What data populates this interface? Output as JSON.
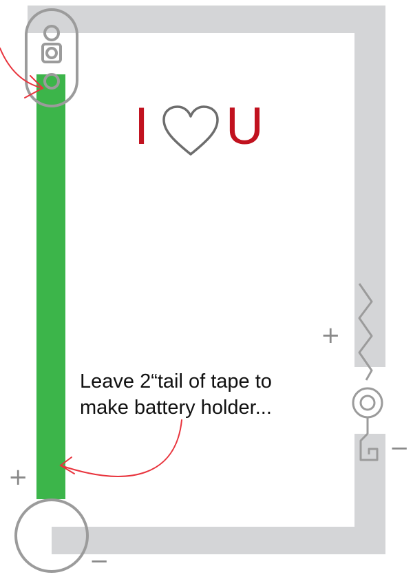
{
  "title": {
    "left_letter": "I",
    "right_letter": "U",
    "heart_icon": "heart-outline-icon",
    "text_color": "#c1121f"
  },
  "note": {
    "line1": "Leave 2“tail of tape to",
    "line2": "make battery holder..."
  },
  "polarity": {
    "right_plus": "+",
    "right_minus": "−",
    "left_plus": "+",
    "bottom_minus": "−"
  },
  "colors": {
    "trace": "#d4d5d7",
    "tape": "#3cb54a",
    "component": "#9b9b9b",
    "arrow": "#e8333c",
    "text": "#111111"
  }
}
